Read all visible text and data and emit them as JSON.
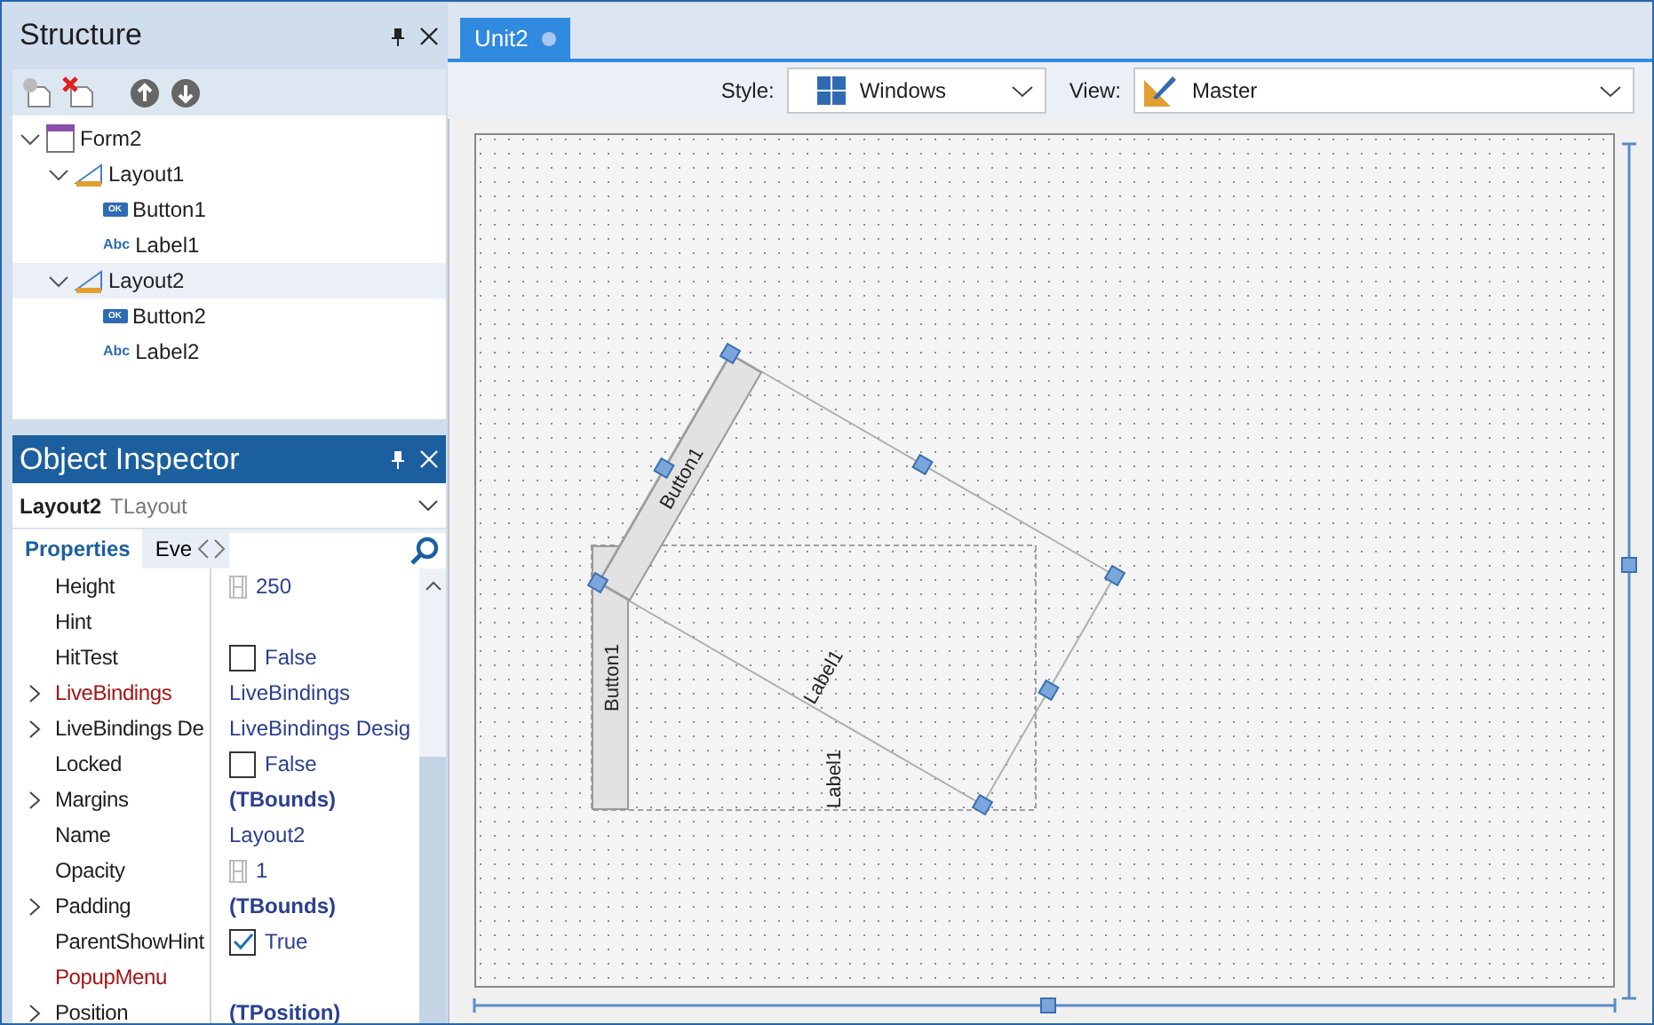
{
  "structure": {
    "title": "Structure",
    "tree": [
      {
        "kind": "form",
        "label": "Form2",
        "expanded": true,
        "selected": false,
        "children": [
          {
            "kind": "layout",
            "label": "Layout1",
            "expanded": true,
            "selected": false,
            "children": [
              {
                "kind": "button",
                "badge": "OK",
                "label": "Button1",
                "selected": false
              },
              {
                "kind": "label",
                "badge": "Abc",
                "label": "Label1",
                "selected": false
              }
            ]
          },
          {
            "kind": "layout",
            "label": "Layout2",
            "expanded": true,
            "selected": true,
            "children": [
              {
                "kind": "button",
                "badge": "OK",
                "label": "Button2",
                "selected": false
              },
              {
                "kind": "label",
                "badge": "Abc",
                "label": "Label2",
                "selected": false
              }
            ]
          }
        ]
      }
    ]
  },
  "inspector": {
    "title": "Object Inspector",
    "object_name": "Layout2",
    "object_type": "TLayout",
    "tabs": [
      {
        "label": "Properties",
        "selected": true
      },
      {
        "label": "Eve",
        "selected": false
      }
    ],
    "properties": [
      {
        "name": "Height",
        "expandable": false,
        "emphasized": false,
        "kind": "number",
        "value": "250"
      },
      {
        "name": "Hint",
        "expandable": false,
        "emphasized": false,
        "kind": "empty"
      },
      {
        "name": "HitTest",
        "expandable": false,
        "emphasized": false,
        "kind": "checkbox",
        "checked": false,
        "value": "False"
      },
      {
        "name": "LiveBindings",
        "expandable": true,
        "emphasized": true,
        "kind": "text",
        "value": "LiveBindings"
      },
      {
        "name": "LiveBindings De",
        "expandable": true,
        "emphasized": false,
        "kind": "text",
        "value": "LiveBindings Desig"
      },
      {
        "name": "Locked",
        "expandable": false,
        "emphasized": false,
        "kind": "checkbox",
        "checked": false,
        "value": "False"
      },
      {
        "name": "Margins",
        "expandable": true,
        "emphasized": false,
        "kind": "bold",
        "value": "(TBounds)"
      },
      {
        "name": "Name",
        "expandable": false,
        "emphasized": false,
        "kind": "text",
        "value": "Layout2"
      },
      {
        "name": "Opacity",
        "expandable": false,
        "emphasized": false,
        "kind": "number",
        "value": "1"
      },
      {
        "name": "Padding",
        "expandable": true,
        "emphasized": false,
        "kind": "bold",
        "value": "(TBounds)"
      },
      {
        "name": "ParentShowHint",
        "expandable": false,
        "emphasized": false,
        "kind": "checkbox",
        "checked": true,
        "value": "True"
      },
      {
        "name": "PopupMenu",
        "expandable": false,
        "emphasized": true,
        "kind": "empty"
      },
      {
        "name": "Position",
        "expandable": true,
        "emphasized": false,
        "kind": "bold",
        "value": "(TPosition)"
      }
    ]
  },
  "editor": {
    "tabs": [
      {
        "label": "Unit2",
        "selected": true
      }
    ],
    "style_label": "Style:",
    "style": "Windows",
    "view_label": "View:",
    "view": "Master",
    "layouts": [
      {
        "rotated": false,
        "selected": false,
        "items": [
          {
            "kind": "button",
            "text": "Button1"
          },
          {
            "kind": "label",
            "text": "Label1"
          }
        ]
      },
      {
        "rotated": true,
        "selected": true,
        "items": [
          {
            "kind": "button",
            "text": "Button1"
          },
          {
            "kind": "label",
            "text": "Label1"
          }
        ]
      }
    ]
  }
}
